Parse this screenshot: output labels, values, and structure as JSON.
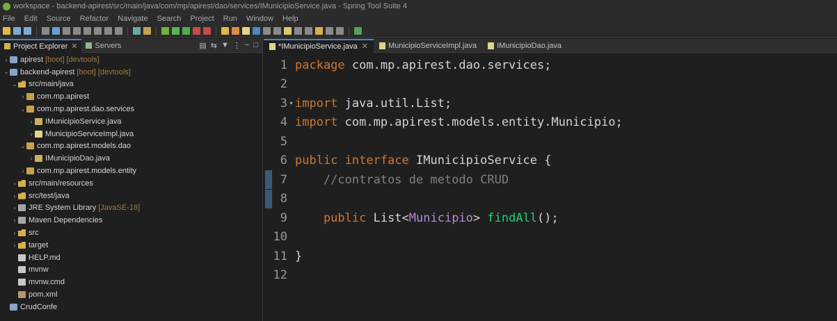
{
  "window": {
    "title": "workspace - backend-apirest/src/main/java/com/mp/apirest/dao/services/IMunicipioService.java - Spring Tool Suite 4"
  },
  "menu": [
    "File",
    "Edit",
    "Source",
    "Refactor",
    "Navigate",
    "Search",
    "Project",
    "Run",
    "Window",
    "Help"
  ],
  "explorer": {
    "tabs": [
      {
        "label": "Project Explorer",
        "active": true
      },
      {
        "label": "Servers",
        "active": false
      }
    ],
    "tree": [
      {
        "depth": 0,
        "arrow": "›",
        "icon": "project",
        "label": "apirest",
        "decoration": "[boot] [devtools]"
      },
      {
        "depth": 0,
        "arrow": "⌄",
        "icon": "project",
        "label": "backend-apirest",
        "decoration": "[boot] [devtools]"
      },
      {
        "depth": 1,
        "arrow": "⌄",
        "icon": "folder",
        "label": "src/main/java",
        "decoration": ""
      },
      {
        "depth": 2,
        "arrow": "›",
        "icon": "pkg",
        "label": "com.mp.apirest",
        "decoration": ""
      },
      {
        "depth": 2,
        "arrow": "⌄",
        "icon": "pkg",
        "label": "com.mp.apirest.dao.services",
        "decoration": ""
      },
      {
        "depth": 3,
        "arrow": "›",
        "icon": "java-int",
        "label": "IMunicipioService.java",
        "decoration": ""
      },
      {
        "depth": 3,
        "arrow": "›",
        "icon": "java",
        "label": "MunicipioServiceImpl.java",
        "decoration": ""
      },
      {
        "depth": 2,
        "arrow": "⌄",
        "icon": "pkg",
        "label": "com.mp.apirest.models.dao",
        "decoration": ""
      },
      {
        "depth": 3,
        "arrow": "›",
        "icon": "java-int",
        "label": "IMunicipioDao.java",
        "decoration": ""
      },
      {
        "depth": 2,
        "arrow": "›",
        "icon": "pkg",
        "label": "com.mp.apirest.models.entity",
        "decoration": ""
      },
      {
        "depth": 1,
        "arrow": "›",
        "icon": "folder",
        "label": "src/main/resources",
        "decoration": ""
      },
      {
        "depth": 1,
        "arrow": "›",
        "icon": "folder",
        "label": "src/test/java",
        "decoration": ""
      },
      {
        "depth": 1,
        "arrow": "›",
        "icon": "lib",
        "label": "JRE System Library",
        "decoration": "[JavaSE-18]"
      },
      {
        "depth": 1,
        "arrow": "›",
        "icon": "lib",
        "label": "Maven Dependencies",
        "decoration": ""
      },
      {
        "depth": 1,
        "arrow": "›",
        "icon": "folder",
        "label": "src",
        "decoration": ""
      },
      {
        "depth": 1,
        "arrow": "›",
        "icon": "folder",
        "label": "target",
        "decoration": ""
      },
      {
        "depth": 1,
        "arrow": "",
        "icon": "file",
        "label": "HELP.md",
        "decoration": ""
      },
      {
        "depth": 1,
        "arrow": "",
        "icon": "file",
        "label": "mvnw",
        "decoration": ""
      },
      {
        "depth": 1,
        "arrow": "",
        "icon": "file",
        "label": "mvnw.cmd",
        "decoration": ""
      },
      {
        "depth": 1,
        "arrow": "",
        "icon": "xml",
        "label": "pom.xml",
        "decoration": ""
      },
      {
        "depth": 0,
        "arrow": "",
        "icon": "project",
        "label": "CrudConfe",
        "decoration": ""
      }
    ]
  },
  "editor": {
    "tabs": [
      {
        "label": "*IMunicipioService.java",
        "active": true,
        "closable": true
      },
      {
        "label": "MunicipioServiceImpl.java",
        "active": false,
        "closable": false
      },
      {
        "label": "IMunicipioDao.java",
        "active": false,
        "closable": false
      }
    ],
    "lines": [
      {
        "n": "1",
        "tokens": [
          {
            "t": "package",
            "c": "kw"
          },
          {
            "t": " com.mp.apirest.dao.services;",
            "c": "plain"
          }
        ]
      },
      {
        "n": "2",
        "tokens": []
      },
      {
        "n": "3",
        "fold": "•",
        "tokens": [
          {
            "t": "import",
            "c": "kw"
          },
          {
            "t": " java.util.List;",
            "c": "plain"
          }
        ]
      },
      {
        "n": "4",
        "tokens": [
          {
            "t": "import",
            "c": "kw"
          },
          {
            "t": " com.mp.apirest.models.entity.Municipio;",
            "c": "plain"
          }
        ]
      },
      {
        "n": "5",
        "tokens": []
      },
      {
        "n": "6",
        "tokens": [
          {
            "t": "public",
            "c": "kw"
          },
          {
            "t": " ",
            "c": "plain"
          },
          {
            "t": "interface",
            "c": "kw"
          },
          {
            "t": " IMunicipioService {",
            "c": "plain"
          }
        ]
      },
      {
        "n": "7",
        "marker": true,
        "tokens": [
          {
            "t": "    //",
            "c": "comment"
          },
          {
            "t": "contratos",
            "c": "comment sq"
          },
          {
            "t": " ",
            "c": "comment"
          },
          {
            "t": "de",
            "c": "comment sq"
          },
          {
            "t": " ",
            "c": "comment"
          },
          {
            "t": "metodo",
            "c": "comment sq"
          },
          {
            "t": " CRUD",
            "c": "comment"
          }
        ]
      },
      {
        "n": "8",
        "marker": true,
        "tokens": []
      },
      {
        "n": "9",
        "tokens": [
          {
            "t": "    public",
            "c": "kw"
          },
          {
            "t": " List<",
            "c": "plain"
          },
          {
            "t": "Municipio",
            "c": "type"
          },
          {
            "t": "> ",
            "c": "plain"
          },
          {
            "t": "findAll",
            "c": "method"
          },
          {
            "t": "();",
            "c": "plain"
          }
        ]
      },
      {
        "n": "10",
        "tokens": []
      },
      {
        "n": "11",
        "tokens": [
          {
            "t": "}",
            "c": "plain"
          }
        ]
      },
      {
        "n": "12",
        "tokens": []
      }
    ]
  },
  "colors": {
    "background": "#1f1f1f",
    "keyword": "#cc7832",
    "type": "#b68bd6",
    "method": "#1fd07a",
    "accent": "#4a88c7"
  }
}
